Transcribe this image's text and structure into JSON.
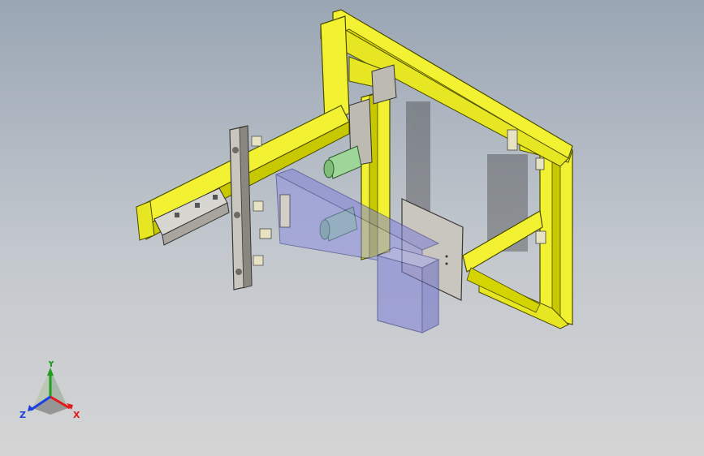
{
  "colors": {
    "frame_yellow": "#f2f233",
    "frame_yellow_dark": "#a8a800",
    "plate_gray": "#c9c6bf",
    "plate_gray_dark": "#6e6b66",
    "cylinder_green": "#9ed69a",
    "transparent_blue": "#7d7fd6",
    "axis_x": "#e01b1b",
    "axis_y": "#1f9d1f",
    "axis_z": "#1b3fe0"
  },
  "triad": {
    "x_label": "X",
    "y_label": "Y",
    "z_label": "Z"
  },
  "icons": {
    "triad": "coordinate-triad-icon"
  }
}
